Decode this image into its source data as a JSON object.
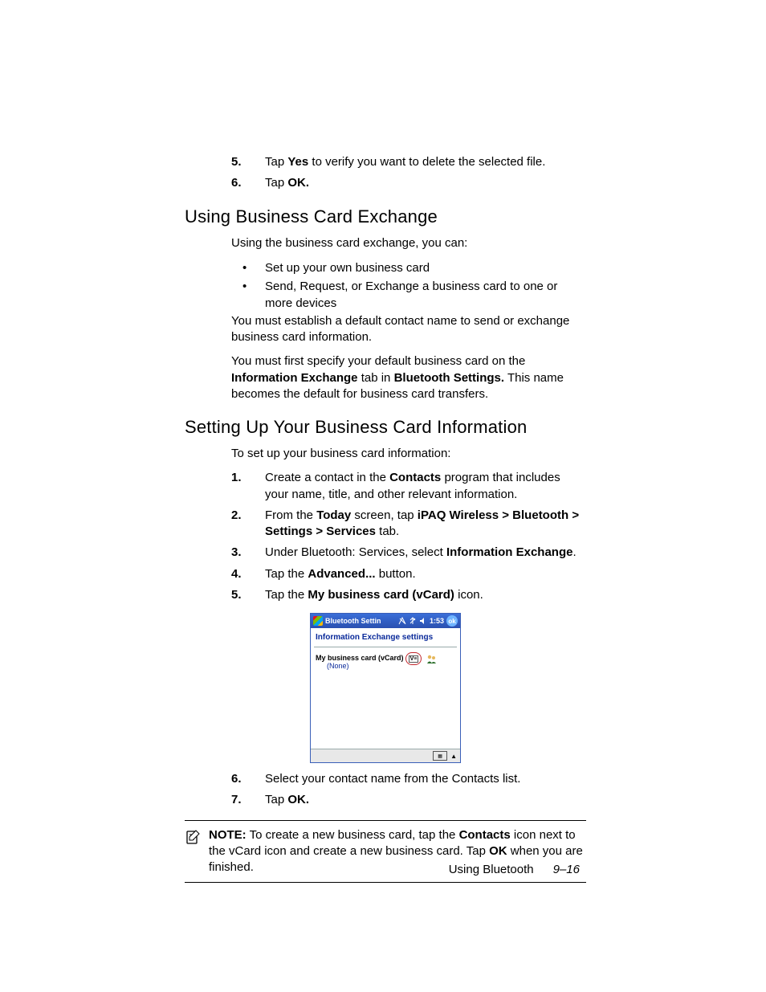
{
  "pre_list": [
    {
      "num": "5.",
      "parts": [
        {
          "t": "Tap "
        },
        {
          "t": "Yes",
          "b": true
        },
        {
          "t": " to verify you want to delete the selected file."
        }
      ]
    },
    {
      "num": "6.",
      "parts": [
        {
          "t": "Tap "
        },
        {
          "t": "OK.",
          "b": true
        }
      ]
    }
  ],
  "h1": "Using Business Card Exchange",
  "p1": "Using the business card exchange, you can:",
  "bullets": [
    "Set up your own business card",
    "Send, Request, or Exchange a business card to one or more devices"
  ],
  "p2": "You must establish a default contact name to send or exchange business card information.",
  "p3": [
    {
      "t": "You must first specify your default business card on the "
    },
    {
      "t": "Information Exchange",
      "b": true
    },
    {
      "t": " tab in "
    },
    {
      "t": "Bluetooth Settings.",
      "b": true
    },
    {
      "t": " This name becomes the default for business card transfers."
    }
  ],
  "h2": "Setting Up Your Business Card Information",
  "p4": "To set up your business card information:",
  "steps": [
    {
      "num": "1.",
      "parts": [
        {
          "t": "Create a contact in the "
        },
        {
          "t": "Contacts",
          "b": true
        },
        {
          "t": " program that includes your name, title, and other relevant information."
        }
      ]
    },
    {
      "num": "2.",
      "parts": [
        {
          "t": "From the "
        },
        {
          "t": "Today",
          "b": true
        },
        {
          "t": " screen, tap "
        },
        {
          "t": "iPAQ Wireless > Bluetooth > Settings > Services",
          "b": true
        },
        {
          "t": " tab."
        }
      ]
    },
    {
      "num": "3.",
      "parts": [
        {
          "t": "Under Bluetooth: Services, select "
        },
        {
          "t": "Information Exchange",
          "b": true
        },
        {
          "t": "."
        }
      ]
    },
    {
      "num": "4.",
      "parts": [
        {
          "t": "Tap the "
        },
        {
          "t": "Advanced...",
          "b": true
        },
        {
          "t": " button."
        }
      ]
    },
    {
      "num": "5.",
      "parts": [
        {
          "t": "Tap the "
        },
        {
          "t": "My business card (vCard)",
          "b": true
        },
        {
          "t": " icon."
        }
      ]
    }
  ],
  "screenshot": {
    "title": "Bluetooth Settin",
    "time": "1:53",
    "ok": "ok",
    "section": "Information Exchange settings",
    "label": "My business card (vCard)",
    "value": "(None)",
    "vcard_txt": "V≡"
  },
  "post_steps": [
    {
      "num": "6.",
      "parts": [
        {
          "t": "Select your contact name from the Contacts list."
        }
      ]
    },
    {
      "num": "7.",
      "parts": [
        {
          "t": "Tap "
        },
        {
          "t": "OK.",
          "b": true
        }
      ]
    }
  ],
  "note": [
    {
      "t": "NOTE:",
      "b": true
    },
    {
      "t": " To create a new business card, tap the "
    },
    {
      "t": "Contacts",
      "b": true
    },
    {
      "t": " icon next to the vCard icon and create a new business card. Tap "
    },
    {
      "t": "OK",
      "b": true
    },
    {
      "t": " when you are finished."
    }
  ],
  "footer": {
    "section": "Using Bluetooth",
    "page": "9–16"
  }
}
